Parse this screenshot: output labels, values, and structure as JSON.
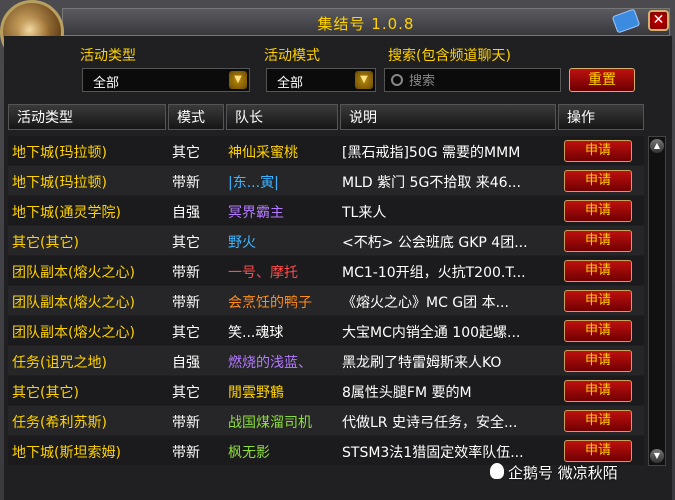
{
  "window": {
    "title": "集结号 1.0.8"
  },
  "filters": {
    "activity_type_label": "活动类型",
    "activity_type_value": "全部",
    "activity_mode_label": "活动模式",
    "activity_mode_value": "全部",
    "search_label": "搜索(包含频道聊天)",
    "search_placeholder": "搜索",
    "reset_label": "重置"
  },
  "table": {
    "headers": [
      "活动类型",
      "模式",
      "队长",
      "说明",
      "操作"
    ],
    "apply_label": "申请",
    "rows": [
      {
        "type": "地下城(玛拉顿)",
        "mode": "其它",
        "leader": "神仙采蜜桃",
        "leader_color": "#ffd200",
        "desc": "[黑石戒指]50G 需要的MMM"
      },
      {
        "type": "地下城(玛拉顿)",
        "mode": "带新",
        "leader": "|东...寅|",
        "leader_color": "#3cb4ff",
        "desc": "MLD 紫门 5G不拾取 来46..."
      },
      {
        "type": "地下城(通灵学院)",
        "mode": "自强",
        "leader": "冥界霸主",
        "leader_color": "#b47aff",
        "desc": "TL来人"
      },
      {
        "type": "其它(其它)",
        "mode": "其它",
        "leader": "野火",
        "leader_color": "#3cb4ff",
        "desc": "<不朽> 公会班底 GKP 4团..."
      },
      {
        "type": "团队副本(熔火之心)",
        "mode": "带新",
        "leader": "一号、摩托",
        "leader_color": "#ff4b4b",
        "desc": "MC1-10开组，火抗T200.T..."
      },
      {
        "type": "团队副本(熔火之心)",
        "mode": "带新",
        "leader": "会烹饪的鸭子",
        "leader_color": "#ff8c1a",
        "desc": "《熔火之心》MC G团 本..."
      },
      {
        "type": "团队副本(熔火之心)",
        "mode": "其它",
        "leader": "笑...魂球",
        "leader_color": "#ffffff",
        "desc": "大宝MC内销全通 100起螺..."
      },
      {
        "type": "任务(诅咒之地)",
        "mode": "自强",
        "leader": "燃烧的浅蓝、",
        "leader_color": "#b47aff",
        "desc": "黑龙刷了特雷姆斯来人KO"
      },
      {
        "type": "其它(其它)",
        "mode": "其它",
        "leader": "閒雲野鶴",
        "leader_color": "#ffd200",
        "desc": "8属性头腿FM 要的M"
      },
      {
        "type": "任务(希利苏斯)",
        "mode": "带新",
        "leader": "战国煤溜司机",
        "leader_color": "#8cdc3c",
        "desc": "代做LR 史诗弓任务，安全..."
      },
      {
        "type": "地下城(斯坦索姆)",
        "mode": "带新",
        "leader": "枫无影",
        "leader_color": "#8cdc3c",
        "desc": "STSM3法1猎固定效率队伍..."
      }
    ]
  },
  "watermark": "企鹅号 微凉秋陌"
}
